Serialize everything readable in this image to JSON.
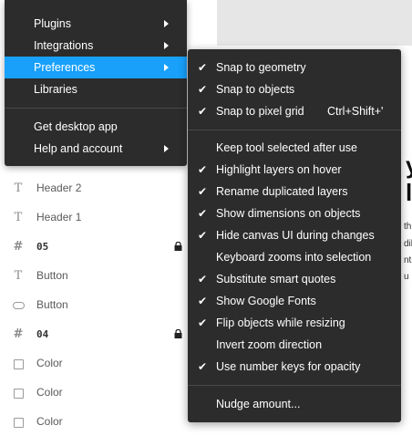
{
  "layers": [
    {
      "icon": "text-icon",
      "glyph": "T",
      "label": "Header 2",
      "locked": false,
      "kind": "text"
    },
    {
      "icon": "text-icon",
      "glyph": "T",
      "label": "Header 1",
      "locked": false,
      "kind": "text"
    },
    {
      "icon": "frame-icon",
      "glyph": "#",
      "label": "05",
      "locked": true,
      "kind": "frame"
    },
    {
      "icon": "text-icon",
      "glyph": "T",
      "label": "Button",
      "locked": false,
      "kind": "text"
    },
    {
      "icon": "pill-icon",
      "glyph": "",
      "label": "Button",
      "locked": false,
      "kind": "pill"
    },
    {
      "icon": "frame-icon",
      "glyph": "#",
      "label": "04",
      "locked": true,
      "kind": "frame"
    },
    {
      "icon": "square-icon",
      "glyph": "",
      "label": "Color",
      "locked": false,
      "kind": "square"
    },
    {
      "icon": "square-icon",
      "glyph": "",
      "label": "Color",
      "locked": false,
      "kind": "square"
    },
    {
      "icon": "square-icon",
      "glyph": "",
      "label": "Color",
      "locked": false,
      "kind": "square"
    }
  ],
  "canvas": {
    "heading_line1": "y",
    "heading_line2": "l",
    "small_lines": [
      "th",
      "dib",
      "nts",
      "u"
    ]
  },
  "menu": {
    "items": [
      {
        "label": "Plugins",
        "submenu": true,
        "active": false
      },
      {
        "label": "Integrations",
        "submenu": true,
        "active": false
      },
      {
        "label": "Preferences",
        "submenu": true,
        "active": true
      },
      {
        "label": "Libraries",
        "submenu": false,
        "active": false
      },
      {
        "label": "Get desktop app",
        "submenu": false,
        "active": false
      },
      {
        "label": "Help and account",
        "submenu": true,
        "active": false
      }
    ]
  },
  "preferences": {
    "check_glyph": "✔",
    "groups": [
      [
        {
          "label": "Snap to geometry",
          "checked": true,
          "shortcut": ""
        },
        {
          "label": "Snap to objects",
          "checked": true,
          "shortcut": ""
        },
        {
          "label": "Snap to pixel grid",
          "checked": true,
          "shortcut": "Ctrl+Shift+'"
        }
      ],
      [
        {
          "label": "Keep tool selected after use",
          "checked": false,
          "shortcut": ""
        },
        {
          "label": "Highlight layers on hover",
          "checked": true,
          "shortcut": ""
        },
        {
          "label": "Rename duplicated layers",
          "checked": true,
          "shortcut": ""
        },
        {
          "label": "Show dimensions on objects",
          "checked": true,
          "shortcut": ""
        },
        {
          "label": "Hide canvas UI during changes",
          "checked": true,
          "shortcut": ""
        },
        {
          "label": "Keyboard zooms into selection",
          "checked": false,
          "shortcut": ""
        },
        {
          "label": "Substitute smart quotes",
          "checked": true,
          "shortcut": ""
        },
        {
          "label": "Show Google Fonts",
          "checked": true,
          "shortcut": ""
        },
        {
          "label": "Flip objects while resizing",
          "checked": true,
          "shortcut": ""
        },
        {
          "label": "Invert zoom direction",
          "checked": false,
          "shortcut": ""
        },
        {
          "label": "Use number keys for opacity",
          "checked": true,
          "shortcut": ""
        }
      ],
      [
        {
          "label": "Nudge amount...",
          "checked": false,
          "shortcut": ""
        }
      ]
    ]
  },
  "colors": {
    "menu_bg": "#2c2c2c",
    "active_bg": "#18a0fb",
    "separator": "#4a4a4a"
  }
}
